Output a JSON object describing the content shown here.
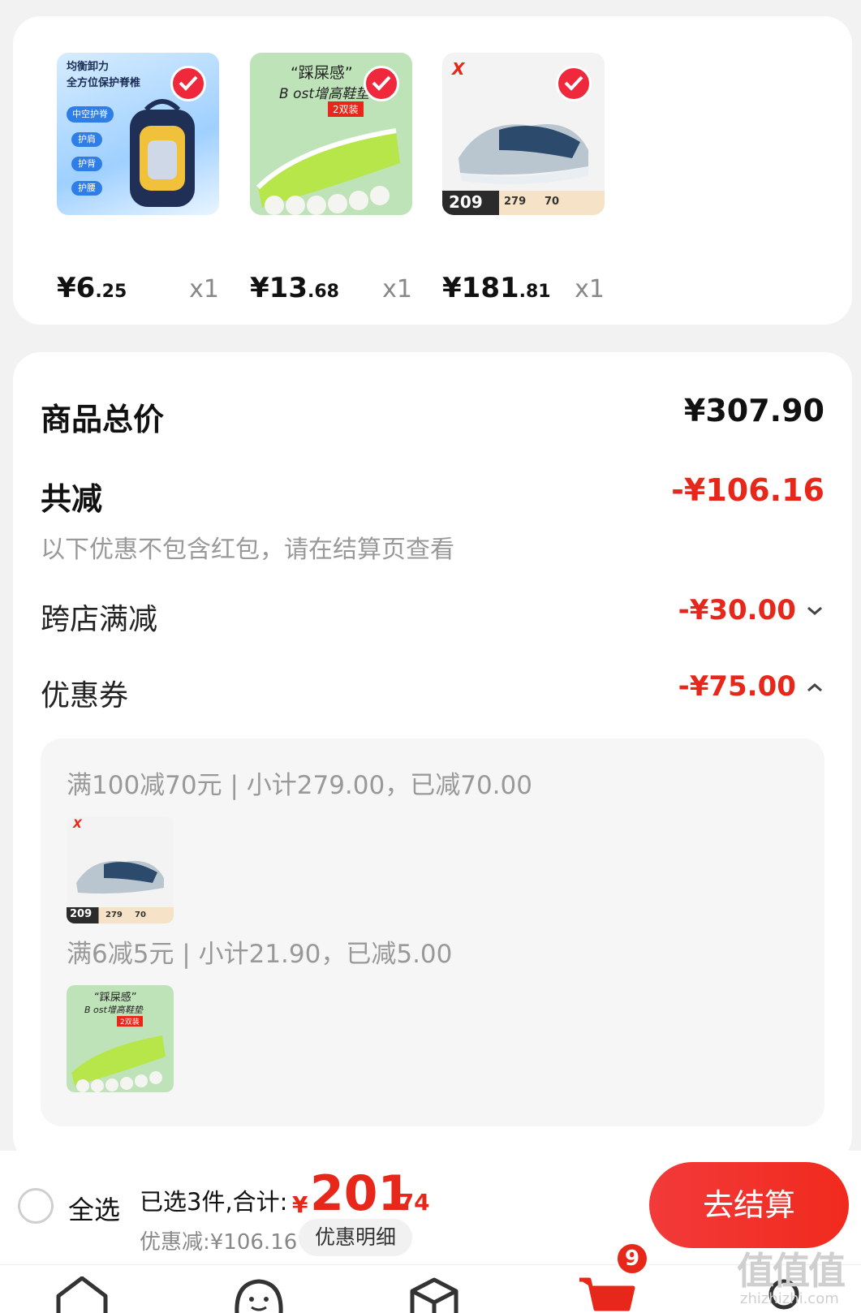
{
  "products": [
    {
      "price_int": "¥6",
      "price_dec": ".25",
      "qty": "x1",
      "image": "backpack",
      "thumb_text": "均衡卸力\n全方位保护脊椎",
      "tags": [
        "中空护脊",
        "护肩",
        "护背",
        "护腰"
      ]
    },
    {
      "price_int": "¥13",
      "price_dec": ".68",
      "qty": "x1",
      "image": "insole",
      "thumb_text": "“踩屎感”",
      "thumb_sub": "B ost增高鞋垫",
      "thumb_tag": "2双装"
    },
    {
      "price_int": "¥181",
      "price_dec": ".81",
      "qty": "x1",
      "image": "sneaker",
      "thumb_price": "209",
      "thumb_nums": [
        "279",
        "70"
      ]
    }
  ],
  "summary": {
    "total_label": "商品总价",
    "total_value": "¥307.90",
    "reduce_label": "共减",
    "reduce_value": "-¥106.16",
    "note": "以下优惠不包含红包，请在结算页查看",
    "cross_store_label": "跨店满减",
    "cross_store_value": "-¥30.00",
    "coupon_label": "优惠券",
    "coupon_value": "-¥75.00"
  },
  "coupon_details": [
    {
      "rule": "满100减70元 | 小计279.00，已减70.00",
      "image": "sneaker"
    },
    {
      "rule": "满6减5元 | 小计21.90，已减5.00",
      "image": "insole"
    }
  ],
  "footer": {
    "select_all": "全选",
    "selected_text": "已选3件,合计:",
    "currency": "¥",
    "total_int": "201",
    "total_dec": ".74",
    "discount_text": "优惠减:¥106.16",
    "detail_button": "优惠明细",
    "checkout_button": "去结算"
  },
  "tabbar": {
    "cart_badge": "9"
  },
  "watermark": {
    "main": "值值值",
    "sub": "zhizhizhi.com"
  },
  "colors": {
    "accent": "#e8271b",
    "check": "#f0283c",
    "background": "#f2f2f2"
  }
}
